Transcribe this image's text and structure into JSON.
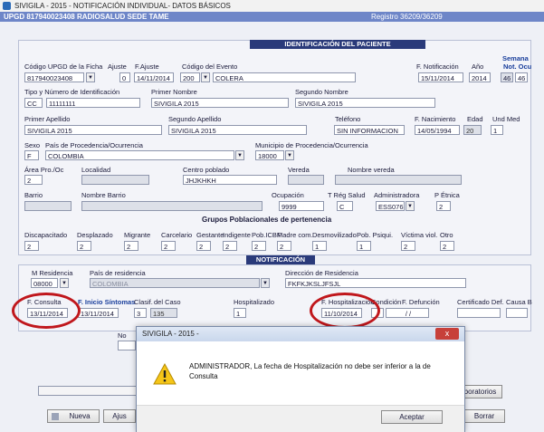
{
  "window": {
    "title": "SIVIGILA - 2015 -  NOTIFICACIÓN INDIVIDUAL- DATOS BÁSICOS",
    "upgd": "UPGD 817940023408 RADIOSALUD SEDE TAME",
    "registro": "Registro 36209/36209"
  },
  "identificacion": {
    "header": "IDENTIFICACIÓN DEL PACIENTE",
    "codigo_upgd_label": "Código UPGD de la Ficha",
    "codigo_upgd": "817940023408",
    "ajuste_label": "Ajuste",
    "ajuste": "0",
    "f_ajuste_label": "F.Ajuste",
    "f_ajuste": "14/11/2014",
    "codigo_evento_label": "Código del Evento",
    "codigo_evento": "200",
    "evento_nombre": "COLERA",
    "f_notificacion_label": "F. Notificación",
    "f_notificacion": "15/11/2014",
    "anio_label": "Año",
    "anio": "2014",
    "semana_label_1": "Semana",
    "semana_label_2": "Not. Ocu",
    "semana_not": "46",
    "semana_ocu": "46",
    "tipo_id_label": "Tipo y Número de Identificación",
    "tipo_id": "CC",
    "numero_id": "11111111",
    "primer_nombre_label": "Primer Nombre",
    "primer_nombre": "SIVIGILA 2015",
    "segundo_nombre_label": "Segundo Nombre",
    "segundo_nombre": "SIVIGILA 2015",
    "primer_apellido_label": "Primer Apellido",
    "primer_apellido": "SIVIGILA 2015",
    "segundo_apellido_label": "Segundo Apellido",
    "segundo_apellido": "SIVIGILA 2015",
    "telefono_label": "Teléfono",
    "telefono": "SIN INFORMACION",
    "f_nacimiento_label": "F. Nacimiento",
    "f_nacimiento": "14/05/1994",
    "edad_label": "Edad",
    "edad": "20",
    "und_med_label": "Und Med",
    "und_med": "1",
    "sexo_label": "Sexo",
    "sexo": "F",
    "pais_proc_label": "País de Procedencia/Ocurrencia",
    "pais_proc": "COLOMBIA",
    "municipio_label": "Municipio de Procedencia/Ocurrencia",
    "municipio": "18000",
    "area_label": "Área Pro./Oc",
    "area": "2",
    "localidad_label": "Localidad",
    "centro_poblado_label": "Centro poblado",
    "centro_poblado": "JHJKHKH",
    "vereda_label": "Vereda",
    "nombre_vereda_label": "Nombre vereda",
    "barrio_label": "Barrio",
    "nombre_barrio_label": "Nombre Barrio",
    "ocupacion_label": "Ocupación",
    "ocupacion": "9999",
    "t_reg_salud_label": "T Rég Salud",
    "t_reg_salud": "C",
    "administradora_label": "Administradora",
    "administradora": "ESS076",
    "p_etnica_label": "P Étnica",
    "p_etnica": "2"
  },
  "grupos": {
    "title": "Grupos Poblacionales de pertenencia",
    "items": [
      {
        "label": "Discapacitado",
        "value": "2"
      },
      {
        "label": "Desplazado",
        "value": "2"
      },
      {
        "label": "Migrante",
        "value": "2"
      },
      {
        "label": "Carcelario",
        "value": "2"
      },
      {
        "label": "Gestante",
        "value": "2"
      },
      {
        "label": "Indigente",
        "value": "2"
      },
      {
        "label": "Pob.ICBF",
        "value": "2"
      },
      {
        "label": "Madre com.",
        "value": "2"
      },
      {
        "label": "Desmovilizado",
        "value": "1"
      },
      {
        "label": "Pob. Psiqui.",
        "value": "1"
      },
      {
        "label": "Víctima viol.",
        "value": "2"
      },
      {
        "label": "Otro",
        "value": "2"
      }
    ]
  },
  "notificacion": {
    "header": "NOTIFICACIÓN",
    "m_residencia_label": "M Residencia",
    "m_residencia": "08000",
    "pais_residencia_label": "País de residencia",
    "pais_residencia": "COLOMBIA",
    "direccion_label": "Dirección de Residencia",
    "direccion": "FKFKJKSLJFSJL",
    "f_consulta_label": "F. Consulta",
    "f_consulta": "13/11/2014",
    "f_inicio_label": "F. Inicio Síntomas",
    "f_inicio": "13/11/2014",
    "clasif_label": "Clasif.",
    "clasif": "3",
    "del_caso_label": "del Caso",
    "del_caso": "135",
    "hospitalizado_label": "Hospitalizado",
    "hospitalizado": "1",
    "f_hosp_label": "F. Hospitalización",
    "f_hosp": "11/10/2014",
    "condicion_label": "Condición",
    "f_defuncion_label": "F. Defunción",
    "f_defuncion": "/ /",
    "certificado_label": "Certificado Def.",
    "causa_label": "Causa B",
    "nota_partial": "No",
    "laboratorios": "Laboratorios",
    "nueva": "Nueva",
    "ajuste_btn": "Ajus",
    "borrar": "Borrar"
  },
  "dialog": {
    "title": "SIVIGILA - 2015 -",
    "message": "ADMINISTRADOR, La fecha de Hospitalización no debe ser inferior a la de Consulta",
    "ok": "Aceptar",
    "close": "x"
  }
}
